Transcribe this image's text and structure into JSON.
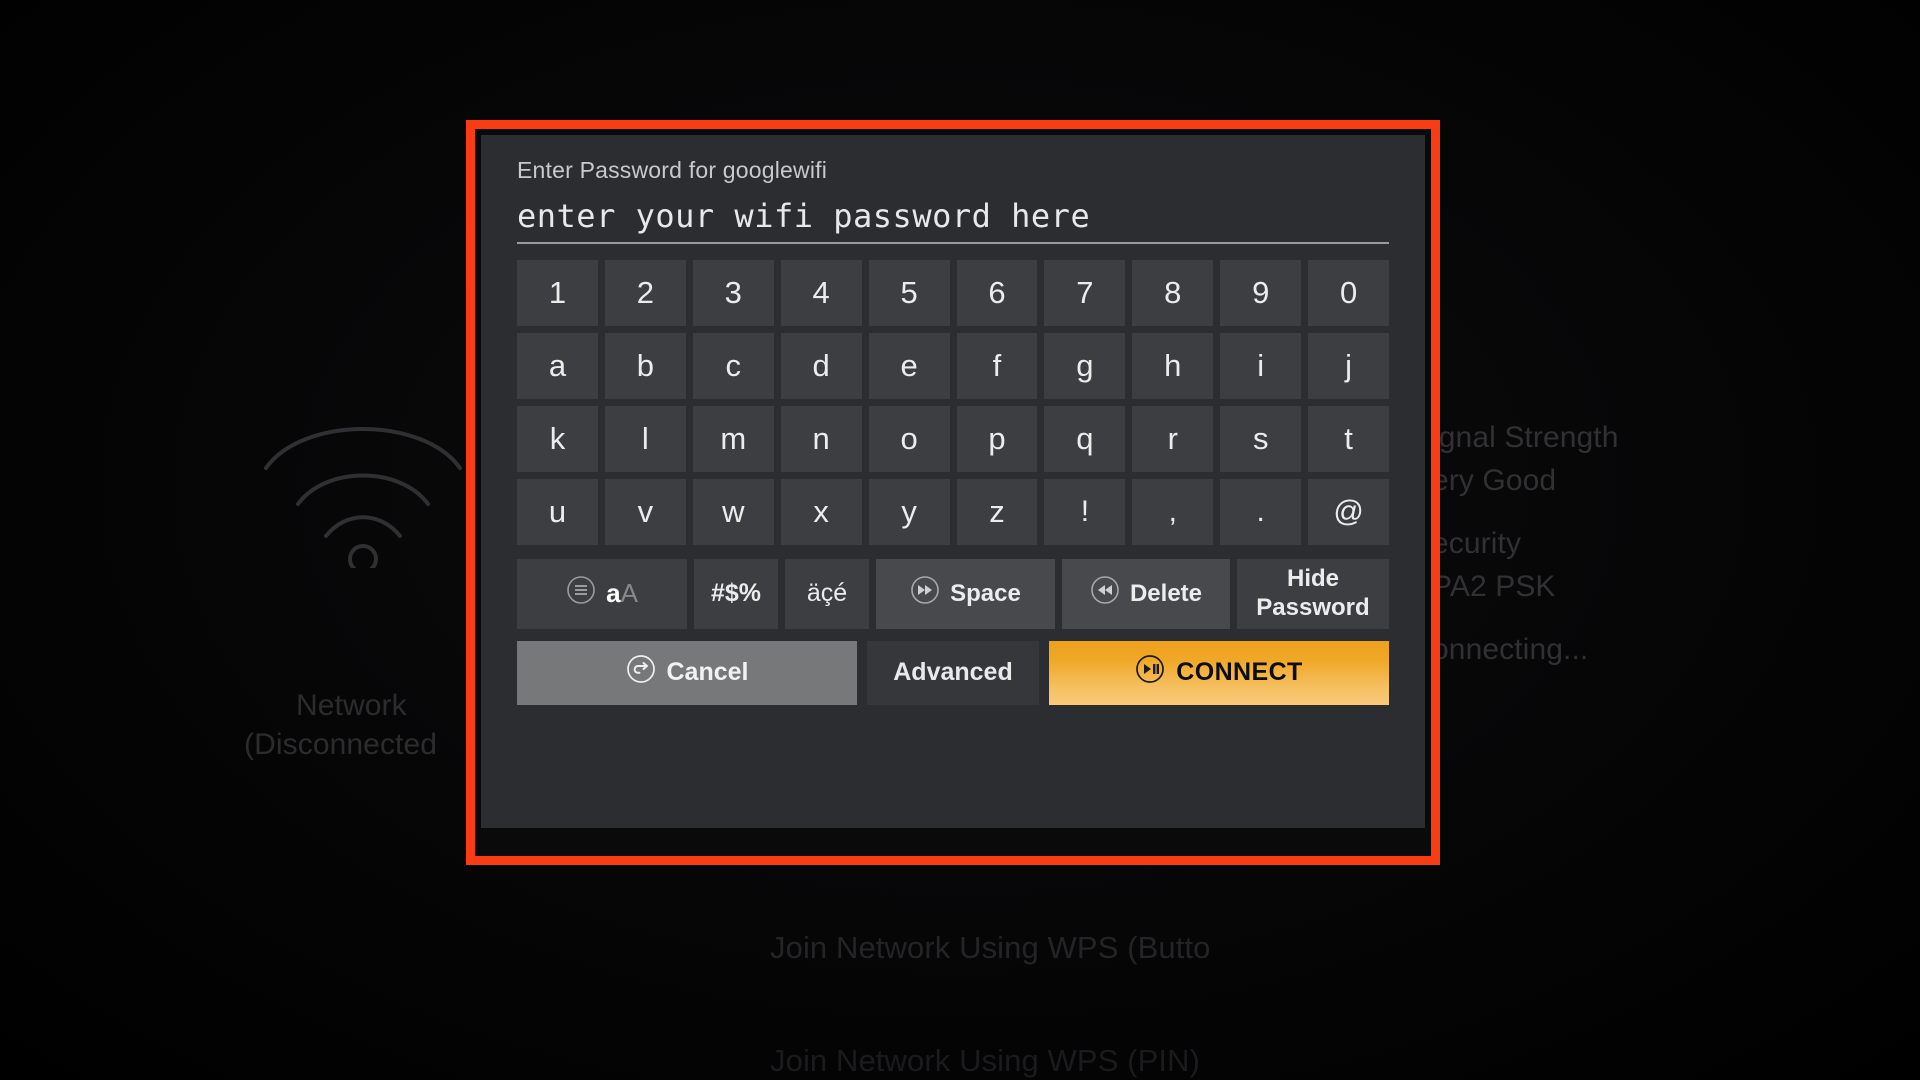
{
  "background": {
    "wifi_icon": "wifi-icon",
    "network_name": "Network",
    "network_status": "(Disconnected",
    "signal_strength_label": "ignal Strength",
    "signal_strength_value": "ery Good",
    "security_label": "ecurity",
    "security_value": "PA2 PSK",
    "connecting_text": "onnecting...",
    "wps_button_option": "Join Network Using WPS (Butto",
    "wps_pin_option": "Join Network Using WPS (PIN)"
  },
  "dialog": {
    "title": "Enter Password for googlewifi",
    "password": {
      "value": "enter your wifi password here",
      "placeholder": "enter your wifi password here"
    },
    "keyboard": {
      "rows": [
        [
          "1",
          "2",
          "3",
          "4",
          "5",
          "6",
          "7",
          "8",
          "9",
          "0"
        ],
        [
          "a",
          "b",
          "c",
          "d",
          "e",
          "f",
          "g",
          "h",
          "i",
          "j"
        ],
        [
          "k",
          "l",
          "m",
          "n",
          "o",
          "p",
          "q",
          "r",
          "s",
          "t"
        ],
        [
          "u",
          "v",
          "w",
          "x",
          "y",
          "z",
          "!",
          ",",
          ".",
          "@"
        ]
      ],
      "function_keys": {
        "case_toggle": {
          "icon": "menu-circle-icon",
          "lower": "a",
          "upper": "A"
        },
        "symbols": "#$%",
        "accents": "äçé",
        "space": {
          "icon": "fast-forward-circle-icon",
          "label": "Space"
        },
        "delete": {
          "icon": "rewind-circle-icon",
          "label": "Delete"
        },
        "hide_password": {
          "line1": "Hide",
          "line2": "Password"
        }
      }
    },
    "actions": {
      "cancel": {
        "icon": "back-arrow-circle-icon",
        "label": "Cancel"
      },
      "advanced": {
        "label": "Advanced"
      },
      "connect": {
        "icon": "play-pause-circle-icon",
        "label": "CONNECT"
      }
    }
  },
  "colors": {
    "highlight_border": "#fa3c14",
    "dialog_bg": "#2b2d30",
    "key_bg": "#3c3e41",
    "connect_gradient_top": "#eda01c",
    "connect_gradient_bottom": "#f8ca7a",
    "cancel_bg": "#77787a"
  }
}
